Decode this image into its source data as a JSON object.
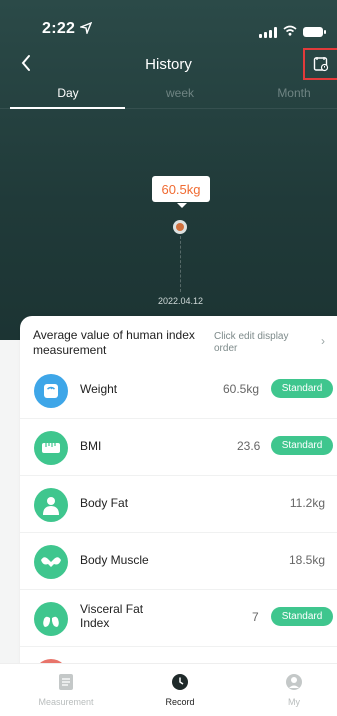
{
  "status_bar": {
    "time": "2:22"
  },
  "header": {
    "title": "History",
    "back_icon": "chevron-left-icon",
    "action_icon": "calendar-icon"
  },
  "tabs": [
    {
      "label": "Day",
      "active": true
    },
    {
      "label": "week",
      "active": false
    },
    {
      "label": "Month",
      "active": false
    }
  ],
  "chart_data": {
    "type": "scatter",
    "x": [
      "2022.04.12"
    ],
    "y": [
      60.5
    ],
    "unit": "kg",
    "highlight_label": "60.5kg"
  },
  "card": {
    "title": "Average value of human index measurement",
    "edit_label": "Click edit display order"
  },
  "metrics": [
    {
      "label": "Weight",
      "value": "60.5kg",
      "badge": "Standard",
      "icon": "scale-icon",
      "color": "#3ea6e8"
    },
    {
      "label": "BMI",
      "value": "23.6",
      "badge": "Standard",
      "icon": "bmi-icon",
      "color": "#3fc68e"
    },
    {
      "label": "Body Fat",
      "value": "11.2kg",
      "badge": "",
      "icon": "body-fat-icon",
      "color": "#3fc68e"
    },
    {
      "label": "Body Muscle",
      "value": "18.5kg",
      "badge": "",
      "icon": "muscle-icon",
      "color": "#3fc68e"
    },
    {
      "label": "Visceral Fat Index",
      "value": "7",
      "badge": "Standard",
      "icon": "lungs-icon",
      "color": "#3fc68e"
    }
  ],
  "bottom_nav": [
    {
      "label": "Measurement",
      "icon": "document-icon",
      "active": false
    },
    {
      "label": "Record",
      "icon": "clock-icon",
      "active": true
    },
    {
      "label": "My",
      "icon": "user-icon",
      "active": false
    }
  ]
}
